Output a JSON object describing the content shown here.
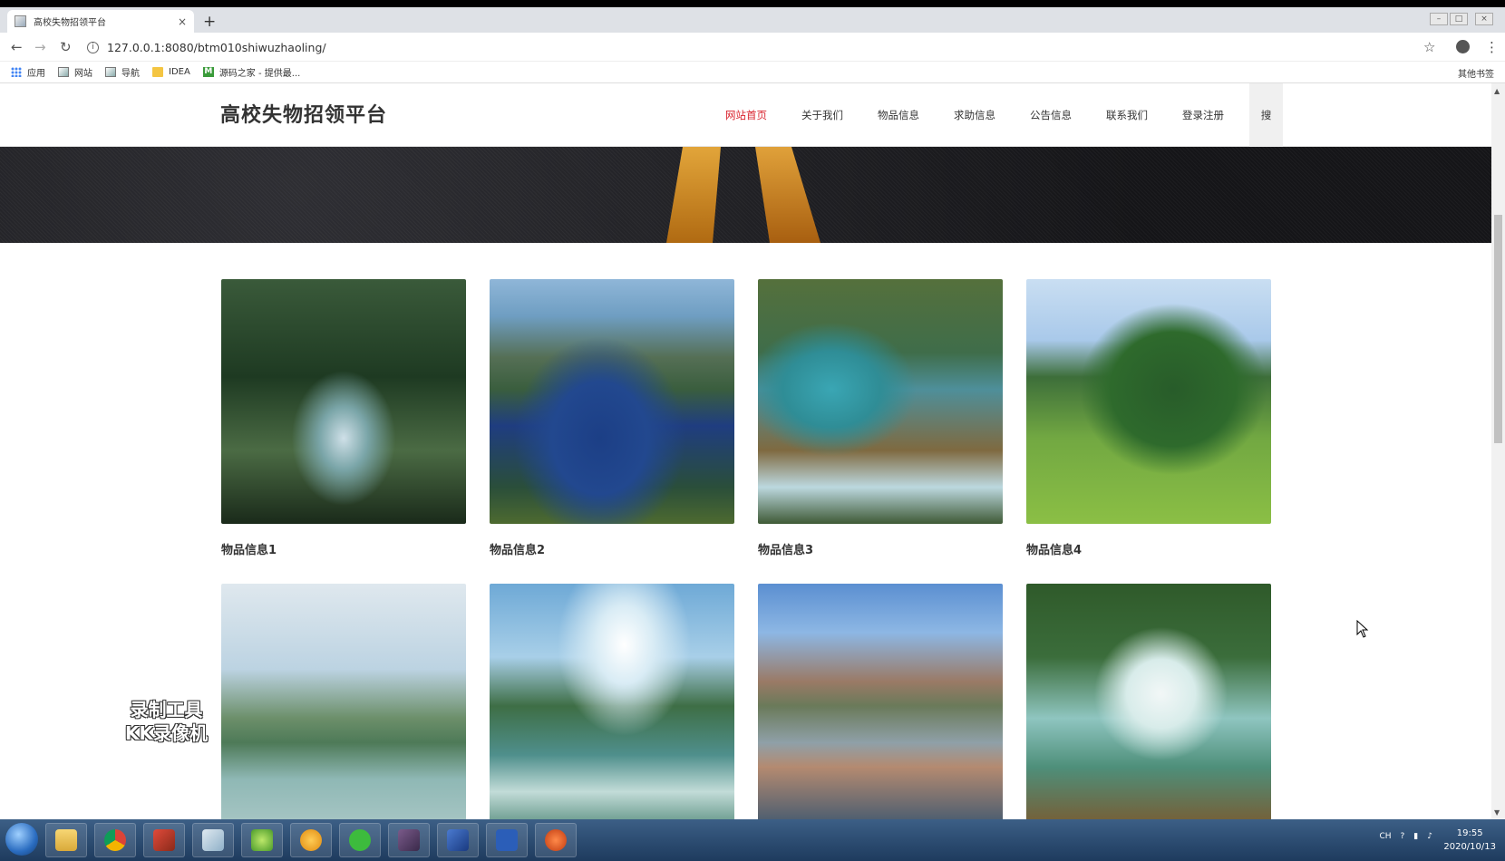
{
  "browser": {
    "tab_title": "高校失物招领平台",
    "tab_close": "×",
    "new_tab": "+",
    "url": "127.0.0.1:8080/btm010shiwuzhaoling/",
    "back": "←",
    "forward": "→",
    "reload": "↻",
    "info": "i",
    "star": "☆",
    "menu": "⋮",
    "window_controls": [
      "–",
      "□",
      "×"
    ]
  },
  "bookmarks": [
    {
      "label": "应用",
      "icon": "apps-grid-icon"
    },
    {
      "label": "网站",
      "icon": "page-icon"
    },
    {
      "label": "导航",
      "icon": "page-icon"
    },
    {
      "label": "IDEA",
      "icon": "folder-icon"
    },
    {
      "label": "源码之家 - 提供最...",
      "icon": "m-logo-icon"
    }
  ],
  "other_bookmarks": "其他书签",
  "site": {
    "brand": "高校失物招领平台",
    "nav": [
      {
        "label": "网站首页",
        "active": true
      },
      {
        "label": "关于我们",
        "active": false
      },
      {
        "label": "物品信息",
        "active": false
      },
      {
        "label": "求助信息",
        "active": false
      },
      {
        "label": "公告信息",
        "active": false
      },
      {
        "label": "联系我们",
        "active": false
      },
      {
        "label": "登录注册",
        "active": false
      }
    ],
    "search_label": "搜",
    "accent_color": "#d9232e",
    "items": [
      {
        "title": "物品信息1"
      },
      {
        "title": "物品信息2"
      },
      {
        "title": "物品信息3"
      },
      {
        "title": "物品信息4"
      },
      {
        "title": ""
      },
      {
        "title": ""
      },
      {
        "title": ""
      },
      {
        "title": ""
      }
    ]
  },
  "watermark": {
    "line1": "录制工具",
    "line2": "KK录像机"
  },
  "taskbar": {
    "apps": [
      "explorer-icon",
      "chrome-icon",
      "app-icon",
      "app-icon",
      "app-icon",
      "search-app-icon",
      "wechat-icon",
      "app-icon",
      "app-icon",
      "word-icon",
      "app-icon"
    ],
    "tray_text": "CH",
    "time": "19:55",
    "date": "2020/10/13"
  }
}
